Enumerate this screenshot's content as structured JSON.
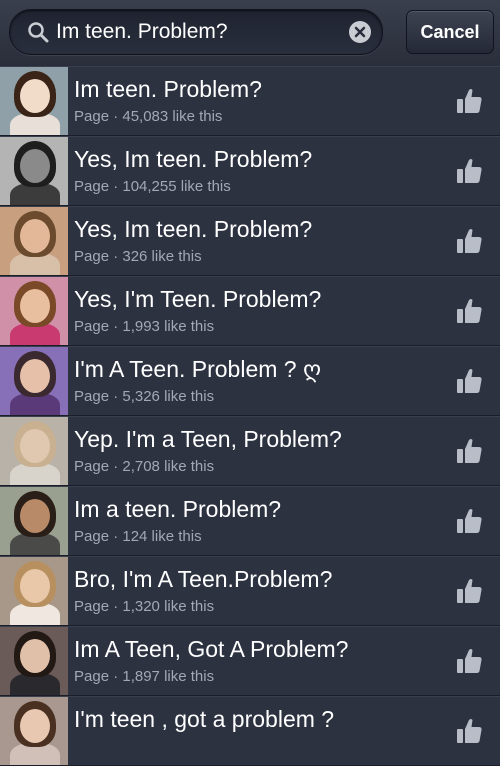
{
  "search": {
    "query": "Im teen. Problem?",
    "cancel_label": "Cancel"
  },
  "results": [
    {
      "name": "Im teen. Problem?",
      "meta": "Page · 45,083 like this",
      "thumb": [
        "#f0dcc8",
        "#3a2418",
        "#e8e0d8",
        "#8fa0a8"
      ]
    },
    {
      "name": "Yes, Im teen. Problem?",
      "meta": "Page · 104,255 like this",
      "thumb": [
        "#8a8a8a",
        "#1e1e1e",
        "#3c3c3c",
        "#b4b4b4"
      ]
    },
    {
      "name": "Yes, Im teen. Problem?",
      "meta": "Page · 326 like this",
      "thumb": [
        "#e2b898",
        "#6b4a2e",
        "#d8c0a8",
        "#c8a080"
      ]
    },
    {
      "name": "Yes, I'm Teen. Problem?",
      "meta": "Page · 1,993 like this",
      "thumb": [
        "#e8c0a0",
        "#7a4a28",
        "#c83a70",
        "#d090a8"
      ]
    },
    {
      "name": "I'm A Teen. Problem ? ღ",
      "meta": "Page · 5,326 like this",
      "thumb": [
        "#e6c0a8",
        "#3a2a30",
        "#5a3a78",
        "#8870b8"
      ]
    },
    {
      "name": "Yep. I'm a Teen, Problem?",
      "meta": "Page · 2,708 like this",
      "thumb": [
        "#e0c8b0",
        "#c8b090",
        "#d8d4cc",
        "#b8b2a8"
      ]
    },
    {
      "name": "Im a teen. Problem?",
      "meta": "Page · 124 like this",
      "thumb": [
        "#b88a68",
        "#2a1e18",
        "#4a4a48",
        "#9aa090"
      ]
    },
    {
      "name": "Bro, I'm A Teen.Problem?",
      "meta": "Page · 1,320 like this",
      "thumb": [
        "#e8c8a8",
        "#b89060",
        "#f0e8e0",
        "#a8988a"
      ]
    },
    {
      "name": "Im A Teen, Got A Problem?",
      "meta": "Page · 1,897 like this",
      "thumb": [
        "#e0c0a8",
        "#221814",
        "#2a2a2e",
        "#6a5a58"
      ]
    },
    {
      "name": "I'm teen , got a problem ?",
      "meta": "",
      "thumb": [
        "#e8c8b0",
        "#4a3020",
        "#d0c0b8",
        "#a89890"
      ]
    }
  ]
}
